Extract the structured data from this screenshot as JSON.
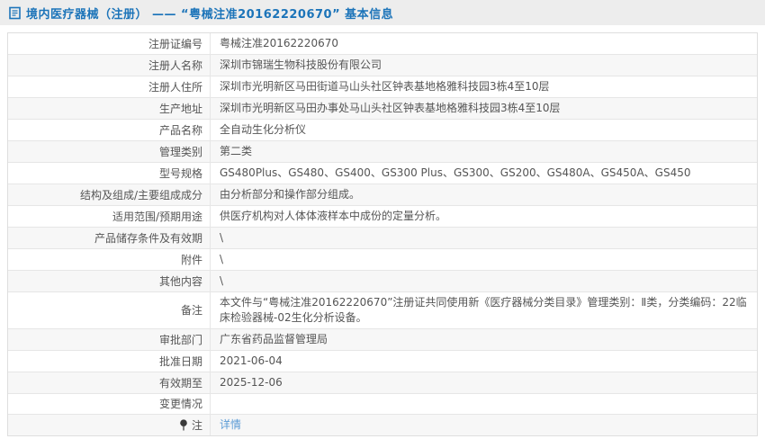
{
  "header": {
    "icon": "document-icon",
    "title": "境内医疗器械（注册） —— “粤械注准20162220670” 基本信息"
  },
  "colors": {
    "title_blue": "#1c74b9",
    "link_blue": "#5b9bd5",
    "titlebar_bg": "#ededed",
    "row_alt_bg": "#f7f7f7",
    "border": "#e6e6e6"
  },
  "table": {
    "rows": [
      {
        "label": "注册证编号",
        "value": "粤械注准20162220670"
      },
      {
        "label": "注册人名称",
        "value": "深圳市锦瑞生物科技股份有限公司"
      },
      {
        "label": "注册人住所",
        "value": "深圳市光明新区马田街道马山头社区钟表基地格雅科技园3栋4至10层"
      },
      {
        "label": "生产地址",
        "value": "深圳市光明新区马田办事处马山头社区钟表基地格雅科技园3栋4至10层"
      },
      {
        "label": "产品名称",
        "value": "全自动生化分析仪"
      },
      {
        "label": "管理类别",
        "value": "第二类"
      },
      {
        "label": "型号规格",
        "value": "GS480Plus、GS480、GS400、GS300 Plus、GS300、GS200、GS480A、GS450A、GS450"
      },
      {
        "label": "结构及组成/主要组成成分",
        "value": "由分析部分和操作部分组成。"
      },
      {
        "label": "适用范围/预期用途",
        "value": "供医疗机构对人体体液样本中成份的定量分析。"
      },
      {
        "label": "产品储存条件及有效期",
        "value": "\\"
      },
      {
        "label": "附件",
        "value": "\\"
      },
      {
        "label": "其他内容",
        "value": "\\"
      },
      {
        "label": "备注",
        "value": "本文件与“粤械注准20162220670”注册证共同使用新《医疗器械分类目录》管理类别：Ⅱ类，分类编码：22临床检验器械-02生化分析设备。"
      },
      {
        "label": "审批部门",
        "value": "广东省药品监督管理局"
      },
      {
        "label": "批准日期",
        "value": "2021-06-04"
      },
      {
        "label": "有效期至",
        "value": "2025-12-06"
      },
      {
        "label": "变更情况",
        "value": ""
      },
      {
        "label": "注",
        "value": "详情",
        "label_icon": "pin-icon",
        "link": true
      }
    ]
  }
}
